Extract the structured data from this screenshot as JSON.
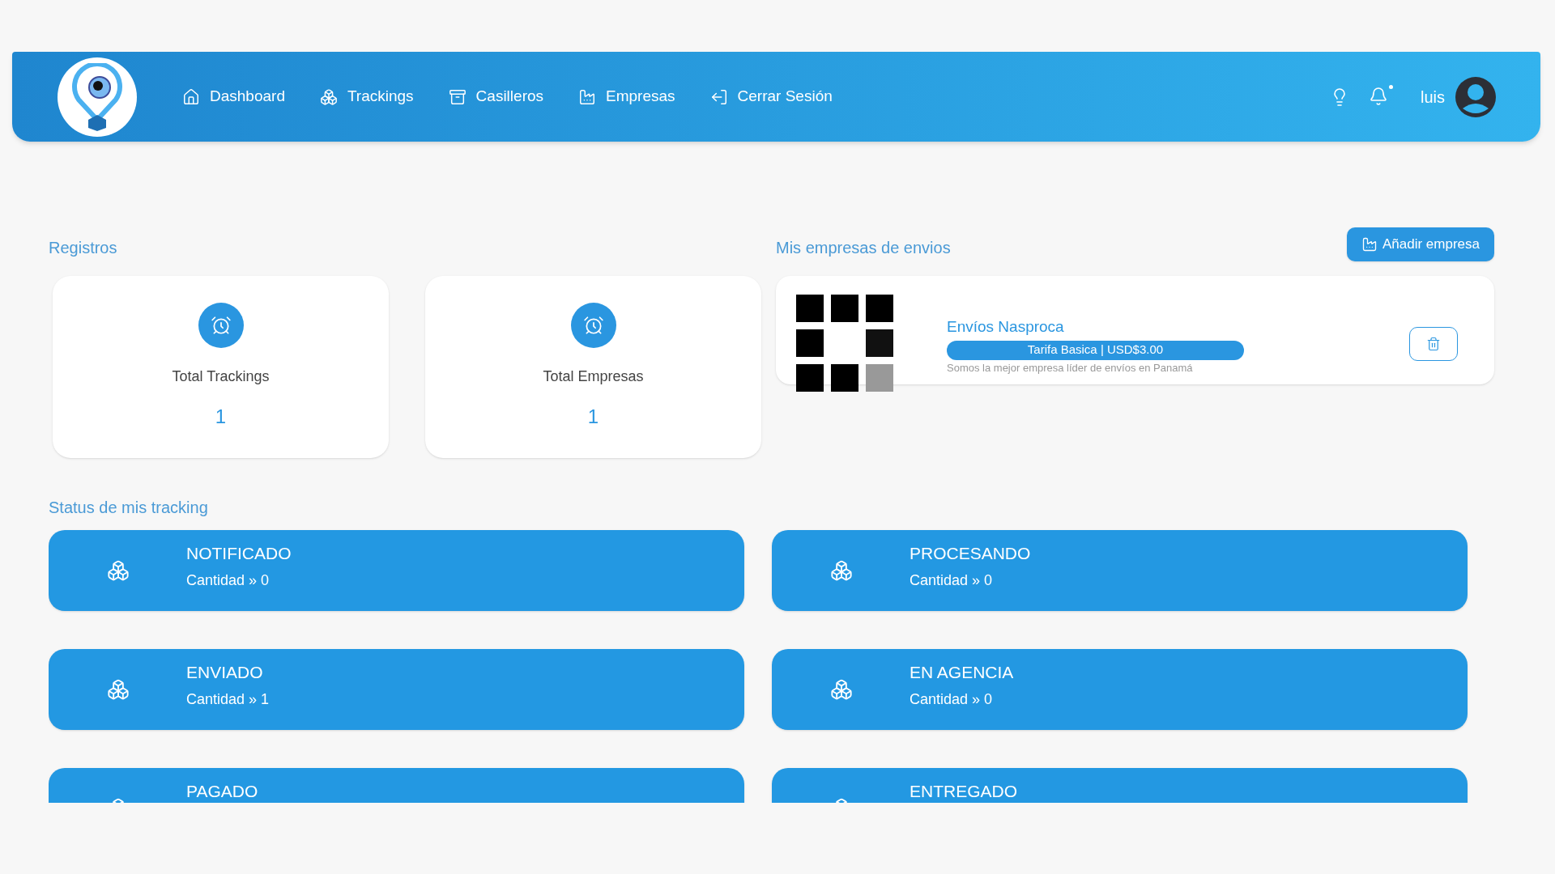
{
  "nav": {
    "items": [
      {
        "label": "Dashboard"
      },
      {
        "label": "Trackings"
      },
      {
        "label": "Casilleros"
      },
      {
        "label": "Empresas"
      },
      {
        "label": "Cerrar Sesión"
      }
    ],
    "notification_dot": true,
    "user": "luis"
  },
  "registros": {
    "title": "Registros",
    "stats": [
      {
        "label": "Total Trackings",
        "value": "1"
      },
      {
        "label": "Total Empresas",
        "value": "1"
      }
    ]
  },
  "empresas": {
    "title": "Mis empresas de envios",
    "add_button": "Añadir empresa",
    "companies": [
      {
        "name": "Envíos Nasproca",
        "tariff": "Tarifa Basica | USD$3.00",
        "description": "Somos la mejor empresa líder de envíos en Panamá"
      }
    ]
  },
  "status": {
    "title": "Status de mis tracking",
    "cards": [
      {
        "name": "NOTIFICADO",
        "count": "Cantidad » 0"
      },
      {
        "name": "PROCESANDO",
        "count": "Cantidad » 0"
      },
      {
        "name": "ENVIADO",
        "count": "Cantidad » 1"
      },
      {
        "name": "EN AGENCIA",
        "count": "Cantidad » 0"
      },
      {
        "name": "PAGADO"
      },
      {
        "name": "ENTREGADO"
      }
    ]
  }
}
